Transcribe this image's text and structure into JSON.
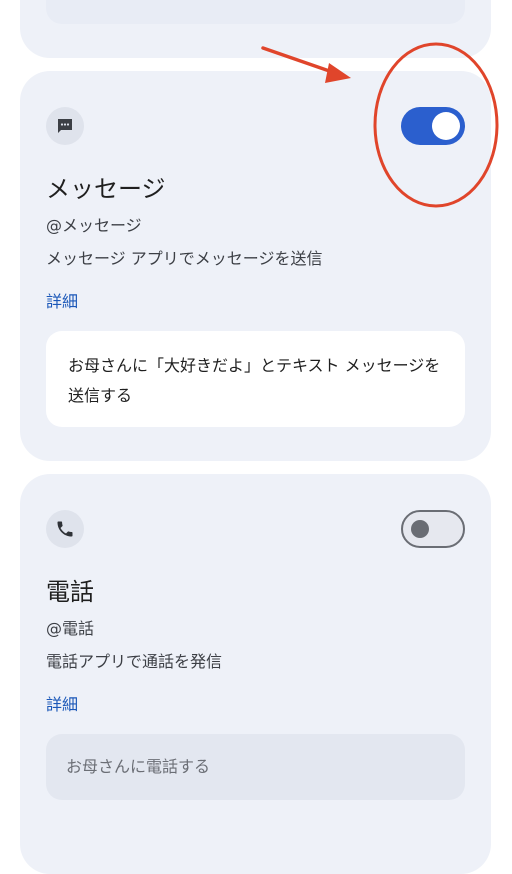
{
  "top_card": {},
  "messages_card": {
    "icon": "chat-bubble-icon",
    "toggle_state": "on",
    "title": "メッセージ",
    "handle": "@メッセージ",
    "description": "メッセージ アプリでメッセージを送信",
    "details_label": "詳細",
    "example": "お母さんに「大好きだよ」とテキスト メッセージを送信する"
  },
  "call_card": {
    "icon": "phone-icon",
    "toggle_state": "off",
    "title": "電話",
    "handle": "@電話",
    "description": "電話アプリで通話を発信",
    "details_label": "詳細",
    "example": "お母さんに電話する"
  },
  "colors": {
    "card_background": "#eef1f8",
    "toggle_on": "#2b5fce",
    "link": "#1a57b8",
    "annotation": "#e0452b"
  },
  "annotation": {
    "arrow": "red-arrow-icon",
    "circle": "red-circle-highlight"
  }
}
